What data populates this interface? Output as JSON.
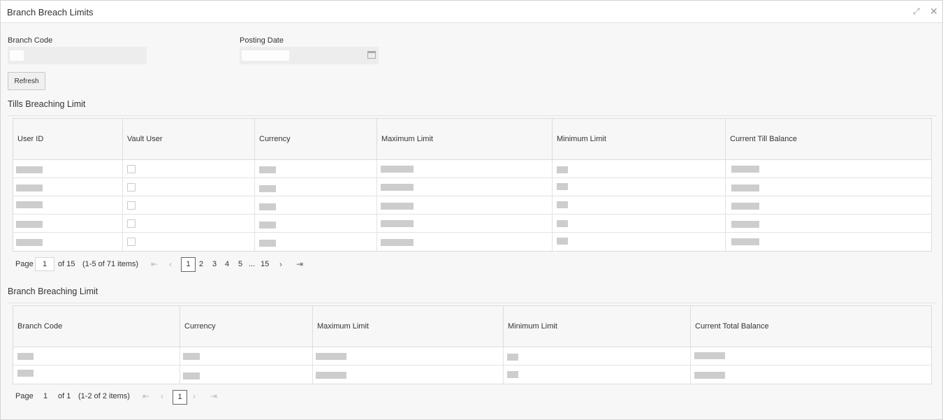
{
  "window": {
    "title": "Branch Breach Limits",
    "icons": [
      "minimize-icon",
      "close-icon"
    ]
  },
  "form": {
    "branch_code_label": "Branch Code",
    "posting_date_label": "Posting Date",
    "refresh_label": "Refresh"
  },
  "tills": {
    "title": "Tills Breaching Limit",
    "columns": [
      "User ID",
      "Vault User",
      "Currency",
      "Maximum Limit",
      "Minimum Limit",
      "Current Till Balance"
    ],
    "pager": {
      "page_label": "Page",
      "current_page": "1",
      "of_label": "of 15",
      "items_label": "(1-5 of 71 items)",
      "pages": [
        "1",
        "2",
        "3",
        "4",
        "5",
        "...",
        "15"
      ]
    }
  },
  "branch": {
    "title": "Branch Breaching Limit",
    "columns": [
      "Branch Code",
      "Currency",
      "Maximum Limit",
      "Minimum Limit",
      "Current Total Balance"
    ],
    "pager": {
      "page_label": "Page",
      "current_page": "1",
      "of_label": "of 1",
      "items_label": "(1-2 of 2 items)",
      "pages": [
        "1"
      ]
    }
  },
  "colors": {
    "background": "#f7f7f7",
    "header_bg": "#f7f7f8",
    "redaction": "#cdcdcd"
  }
}
